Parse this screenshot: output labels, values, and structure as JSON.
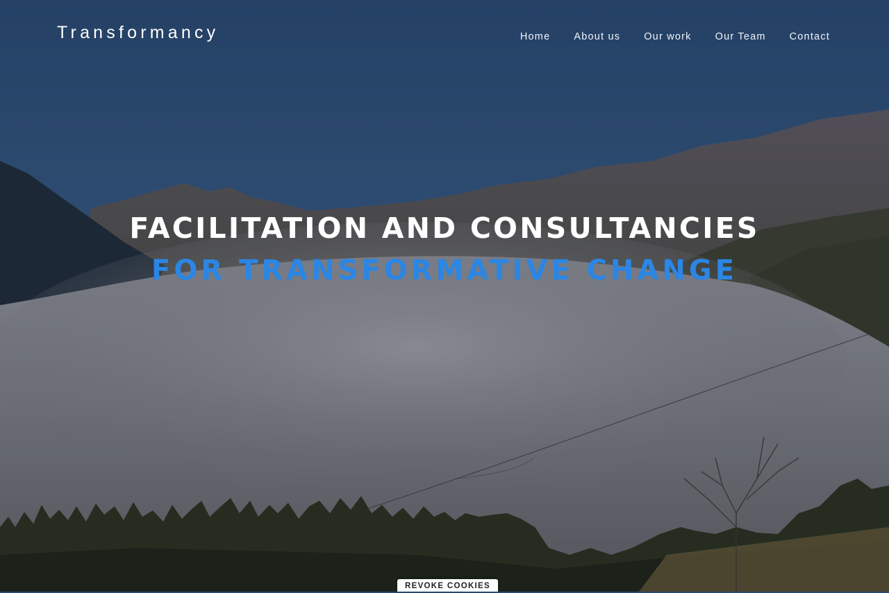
{
  "brand": {
    "name": "Transformancy"
  },
  "nav": {
    "items": [
      {
        "label": "Home"
      },
      {
        "label": "About us"
      },
      {
        "label": "Our work"
      },
      {
        "label": "Our Team"
      },
      {
        "label": "Contact"
      }
    ]
  },
  "hero": {
    "title_line1": "FACILITATION AND CONSULTANCIES",
    "title_line2": "FOR TRANSFORMATIVE CHANGE",
    "accent_color": "#2b86e4"
  },
  "cookie": {
    "button_label": "REVOKE COOKIES"
  }
}
